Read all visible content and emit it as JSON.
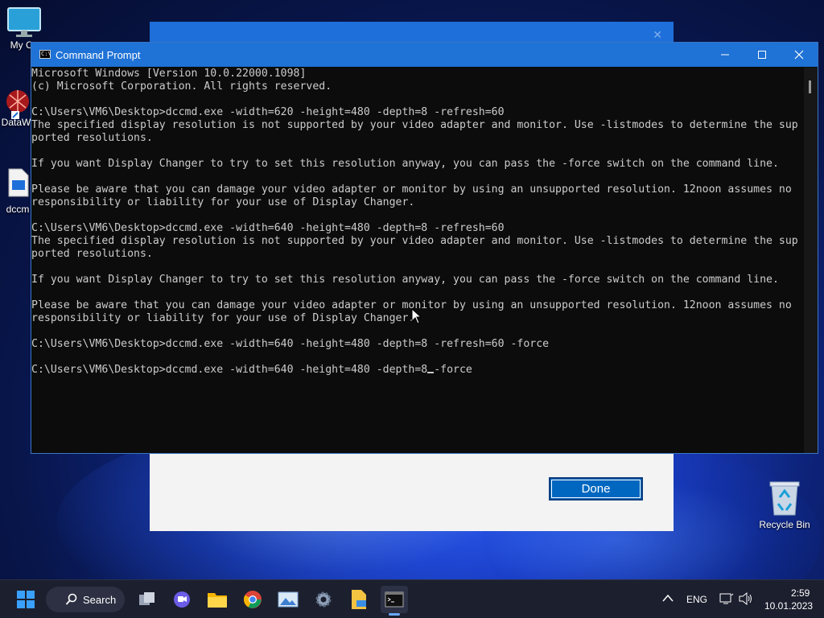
{
  "desktop": {
    "icons": [
      {
        "label": "My Co"
      },
      {
        "label": "DataW"
      },
      {
        "label": "dccm"
      }
    ],
    "recycle_bin": {
      "label": "Recycle Bin"
    }
  },
  "background_window": {
    "done_label": "Done"
  },
  "cmd_window": {
    "title": "Command Prompt",
    "lines": [
      "Microsoft Windows [Version 10.0.22000.1098]",
      "(c) Microsoft Corporation. All rights reserved.",
      "",
      "C:\\Users\\VM6\\Desktop>dccmd.exe -width=620 -height=480 -depth=8 -refresh=60",
      "The specified display resolution is not supported by your video adapter and monitor. Use -listmodes to determine the sup",
      "ported resolutions.",
      "",
      "If you want Display Changer to try to set this resolution anyway, you can pass the -force switch on the command line.",
      "",
      "Please be aware that you can damage your video adapter or monitor by using an unsupported resolution. 12noon assumes no",
      "responsibility or liability for your use of Display Changer.",
      "",
      "C:\\Users\\VM6\\Desktop>dccmd.exe -width=640 -height=480 -depth=8 -refresh=60",
      "The specified display resolution is not supported by your video adapter and monitor. Use -listmodes to determine the sup",
      "ported resolutions.",
      "",
      "If you want Display Changer to try to set this resolution anyway, you can pass the -force switch on the command line.",
      "",
      "Please be aware that you can damage your video adapter or monitor by using an unsupported resolution. 12noon assumes no",
      "responsibility or liability for your use of Display Changer.",
      "",
      "C:\\Users\\VM6\\Desktop>dccmd.exe -width=640 -height=480 -depth=8 -refresh=60 -force",
      ""
    ],
    "prompt_line": "C:\\Users\\VM6\\Desktop>dccmd.exe -width=640 -height=480 -depth=8 -force"
  },
  "taskbar": {
    "search_label": "Search",
    "apps": [
      "start-icon",
      "task-view-icon",
      "teams-chat-icon",
      "file-explorer-icon",
      "chrome-icon",
      "photos-icon",
      "settings-icon",
      "notepad-icon",
      "command-prompt-icon"
    ],
    "language": "ENG",
    "time": "2:59",
    "date": "10.01.2023"
  },
  "colors": {
    "console_bg": "#0c0c0c",
    "console_fg": "#cccccc",
    "titlebar": "#1f72d6",
    "taskbar": "#1c1f2e",
    "accent": "#0067c0"
  }
}
